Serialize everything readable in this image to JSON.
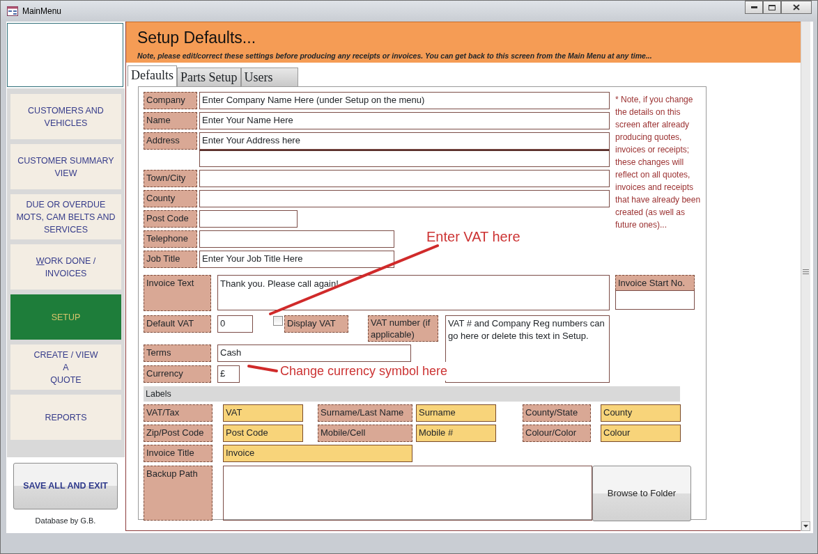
{
  "window": {
    "title": "MainMenu"
  },
  "sidebar": {
    "items": [
      {
        "label": "CUSTOMERS AND\nVEHICLES",
        "selected": false,
        "access_key": false
      },
      {
        "label": "CUSTOMER SUMMARY\nVIEW",
        "selected": false,
        "access_key": false
      },
      {
        "label": "DUE OR OVERDUE\nMOTS, CAM BELTS AND\nSERVICES",
        "selected": false,
        "access_key": false
      },
      {
        "label": "WORK DONE /\nINVOICES",
        "selected": false,
        "access_key": true
      },
      {
        "label": "SETUP",
        "selected": true,
        "access_key": false
      },
      {
        "label": "CREATE / VIEW\nA\nQUOTE",
        "selected": false,
        "access_key": false
      },
      {
        "label": "REPORTS",
        "selected": false,
        "access_key": false
      }
    ],
    "save_button": "SAVE ALL AND EXIT",
    "credit": "Database by G.B."
  },
  "header": {
    "title": "Setup Defaults...",
    "note": "Note, please edit/correct these settings before producing any receipts or invoices. You can get back to this screen from the Main Menu at any time..."
  },
  "tabs": [
    {
      "label": "Defaults",
      "selected": true
    },
    {
      "label": "Parts Setup",
      "selected": false
    },
    {
      "label": "Users",
      "selected": false
    }
  ],
  "details": [
    {
      "kind": "wide",
      "label": "Company",
      "value": "Enter Company Name Here (under Setup on the menu)"
    },
    {
      "kind": "wide",
      "label": "Name",
      "value": "Enter Your Name Here"
    },
    {
      "kind": "address",
      "label": "Address",
      "value": "Enter Your Address here"
    },
    {
      "kind": "wide",
      "label": "Town/City"
    },
    {
      "kind": "wide",
      "label": "County"
    },
    {
      "kind": "short",
      "label": "Post Code"
    },
    {
      "kind": "medium",
      "label": "Telephone"
    },
    {
      "kind": "medium",
      "label": "Job Title",
      "value": "Enter Your Job Title Here"
    }
  ],
  "change_note": "* Note, if you change the details on this screen after already producing quotes, invoices or receipts; these changes will reflect on all quotes, invoices and receipts that have already been created (as well as future ones)...",
  "invoice_text": {
    "label": "Invoice Text",
    "value": "Thank you. Please call again!"
  },
  "invoice_start": {
    "label": "Invoice Start No."
  },
  "vat": {
    "label": "Default VAT",
    "value": "0",
    "display_vat": {
      "label": "Display VAT",
      "checked": false
    },
    "number_label": "VAT number (if applicable)",
    "number_text": "VAT # and Company Reg numbers can go here or delete this text in Setup."
  },
  "terms": {
    "label": "Terms",
    "value": "Cash"
  },
  "currency": {
    "label": "Currency",
    "value": "£"
  },
  "labels": {
    "title": "Labels",
    "rows": [
      [
        {
          "label": "VAT/Tax",
          "value": "VAT"
        },
        {
          "label": "Surname/Last Name",
          "value": "Surname"
        },
        {
          "label": "County/State",
          "value": "County"
        }
      ],
      [
        {
          "label": "Zip/Post Code",
          "value": "Post Code"
        },
        {
          "label": "Mobile/Cell",
          "value": "Mobile #"
        },
        {
          "label": "Colour/Color",
          "value": "Colour"
        }
      ]
    ],
    "invoice_title": {
      "label": "Invoice Title",
      "value": "Invoice"
    }
  },
  "backup": {
    "label": "Backup Path",
    "button": "Browse to Folder"
  },
  "annotations": [
    {
      "text": "Enter VAT here"
    },
    {
      "text": "Change currency symbol here"
    }
  ]
}
